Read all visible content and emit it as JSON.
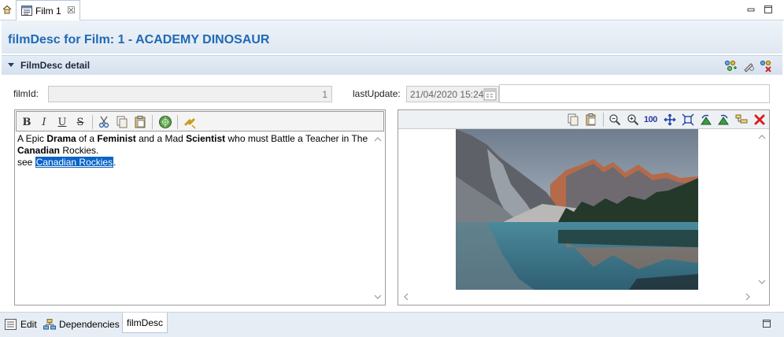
{
  "tabs": [
    {
      "label": "Film 1"
    }
  ],
  "form": {
    "title": "filmDesc for Film: 1 - ACADEMY DINOSAUR"
  },
  "section": {
    "title": "FilmDesc detail"
  },
  "fields": {
    "film_id": {
      "label": "filmId:",
      "value": "1"
    },
    "last_update": {
      "label": "lastUpdate:",
      "value": "21/04/2020 15:24"
    }
  },
  "editor": {
    "toolbar": [
      "B",
      "I",
      "U",
      "S"
    ],
    "text": {
      "t1": "A Epic ",
      "b1": "Drama",
      "t2": " of a ",
      "b2": "Feminist",
      "t3": " and a Mad ",
      "b3": "Scientist",
      "t4": " who must Battle a Teacher in The",
      "b4": "Canadian",
      "t5": " Rockies.",
      "see": "see ",
      "link": "Canadian Rockies",
      "end": "."
    }
  },
  "image_toolbar": {
    "zoom_reset": "100"
  },
  "bottom_tabs": [
    "Edit",
    "Dependencies",
    "filmDesc"
  ],
  "colors": {
    "title": "#1f6ab5",
    "selection": "#0a64c6"
  }
}
